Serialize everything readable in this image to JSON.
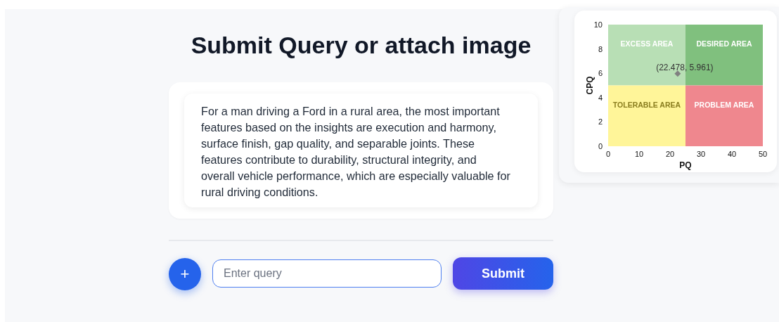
{
  "heading": "Submit Query or attach image",
  "answer": "For a man driving a Ford in a rural area, the most important features based on the insights are execution and harmony, surface finish, gap quality, and separable joints. These features contribute to durability, structural integrity, and overall vehicle performance, which are especially valuable for rural driving conditions.",
  "composer": {
    "attach_label": "+",
    "placeholder": "Enter query",
    "submit_label": "Submit"
  },
  "quadrant_chart": {
    "quadrants": [
      {
        "label": "EXCESS AREA",
        "color": "#b8dfb5"
      },
      {
        "label": "DESIRED AREA",
        "color": "#80c07e"
      },
      {
        "label": "TOLERABLE AREA",
        "color": "#fff599"
      },
      {
        "label": "PROBLEM AREA",
        "color": "#ef878e"
      }
    ],
    "chart_data": {
      "type": "scatter",
      "xlabel": "PQ",
      "ylabel": "CPQ",
      "xlim": [
        0,
        50
      ],
      "ylim": [
        0,
        10
      ],
      "xticks": [
        0,
        10,
        20,
        30,
        40,
        50
      ],
      "yticks": [
        0,
        2,
        4,
        6,
        8,
        10
      ],
      "x": [
        22.478
      ],
      "series": [
        {
          "color": "#808080",
          "values": [
            5.961
          ]
        }
      ],
      "value_labels": [
        "(22.478, 5.961)"
      ]
    }
  }
}
